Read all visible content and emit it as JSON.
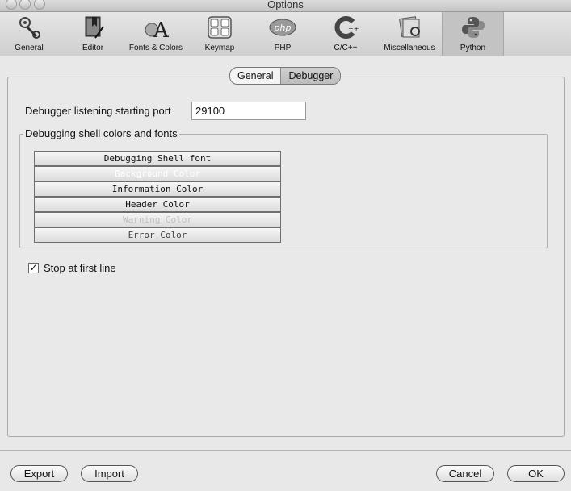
{
  "window": {
    "title": "Options"
  },
  "toolbar": {
    "items": [
      {
        "label": "General"
      },
      {
        "label": "Editor"
      },
      {
        "label": "Fonts & Colors"
      },
      {
        "label": "Keymap"
      },
      {
        "label": "PHP"
      },
      {
        "label": "C/C++"
      },
      {
        "label": "Miscellaneous"
      },
      {
        "label": "Python",
        "selected": true
      }
    ]
  },
  "tabs": {
    "general": "General",
    "debugger": "Debugger",
    "active": "Debugger"
  },
  "debugger": {
    "port_label": "Debugger listening starting port",
    "port_value": "29100",
    "colors_group_label": "Debugging shell colors and fonts",
    "color_buttons": [
      {
        "label": "Debugging Shell font",
        "color": "#111111"
      },
      {
        "label": "Background Color",
        "color": "#ffffff"
      },
      {
        "label": "Information Color",
        "color": "#111111"
      },
      {
        "label": "Header Color",
        "color": "#111111"
      },
      {
        "label": "Warning Color",
        "color": "#c0c0c0"
      },
      {
        "label": "Error Color",
        "color": "#444444"
      }
    ],
    "stop_first_line": {
      "label": "Stop at first line",
      "checked": true
    }
  },
  "footer": {
    "export": "Export",
    "import": "Import",
    "cancel": "Cancel",
    "ok": "OK"
  }
}
